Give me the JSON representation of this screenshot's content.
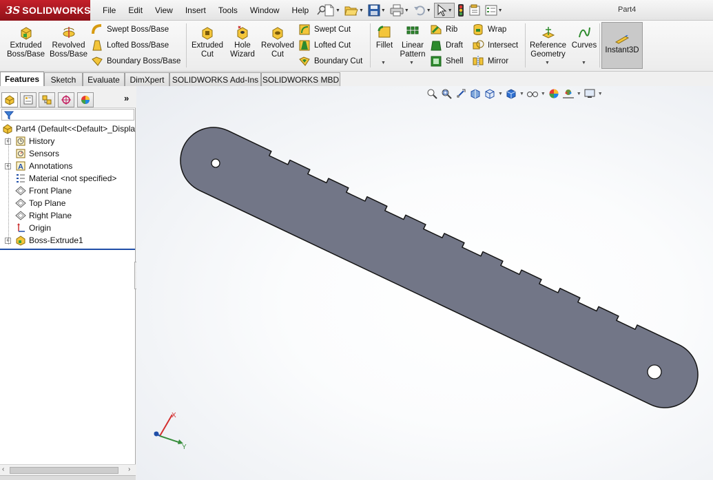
{
  "app": {
    "logo_ds": "3S",
    "logo_text": "SOLIDWORKS",
    "document_title": "Part4"
  },
  "menu": [
    "File",
    "Edit",
    "View",
    "Insert",
    "Tools",
    "Window",
    "Help"
  ],
  "ribbon": {
    "extruded_boss": "Extruded Boss/Base",
    "revolved_boss": "Revolved Boss/Base",
    "swept_boss": "Swept Boss/Base",
    "lofted_boss": "Lofted Boss/Base",
    "boundary_boss": "Boundary Boss/Base",
    "extruded_cut": "Extruded Cut",
    "hole_wizard": "Hole Wizard",
    "revolved_cut": "Revolved Cut",
    "swept_cut": "Swept Cut",
    "lofted_cut": "Lofted Cut",
    "boundary_cut": "Boundary Cut",
    "fillet": "Fillet",
    "linear_pattern": "Linear Pattern",
    "rib": "Rib",
    "draft": "Draft",
    "shell": "Shell",
    "wrap": "Wrap",
    "intersect": "Intersect",
    "mirror": "Mirror",
    "reference_geometry": "Reference Geometry",
    "curves": "Curves",
    "instant3d": "Instant3D"
  },
  "tabs": [
    "Features",
    "Sketch",
    "Evaluate",
    "DimXpert",
    "SOLIDWORKS Add-Ins",
    "SOLIDWORKS MBD"
  ],
  "tree": {
    "root": "Part4  (Default<<Default>_Displa",
    "items": [
      {
        "label": "History"
      },
      {
        "label": "Sensors"
      },
      {
        "label": "Annotations"
      },
      {
        "label": "Material <not specified>"
      },
      {
        "label": "Front Plane"
      },
      {
        "label": "Top Plane"
      },
      {
        "label": "Right Plane"
      },
      {
        "label": "Origin"
      },
      {
        "label": "Boss-Extrude1"
      }
    ]
  },
  "triad": {
    "x": "X",
    "y": "Y"
  },
  "colors": {
    "part_face": "#727687",
    "brand_red": "#b81d26",
    "selection_blue": "#1f4ea8"
  }
}
